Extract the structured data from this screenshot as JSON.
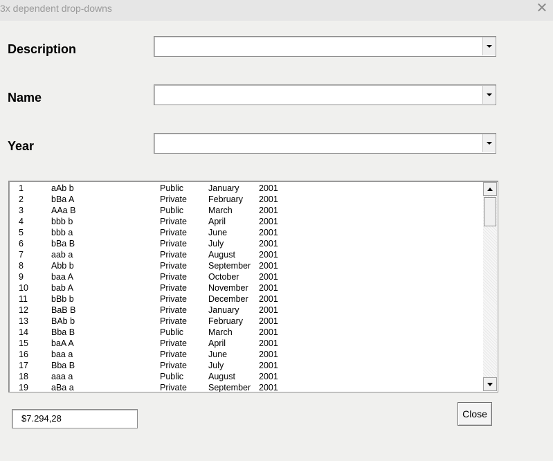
{
  "window": {
    "title": "3x dependent drop-downs",
    "close_glyph": "✕"
  },
  "fields": {
    "description": {
      "label": "Description",
      "value": ""
    },
    "name": {
      "label": "Name",
      "value": ""
    },
    "year": {
      "label": "Year",
      "value": ""
    }
  },
  "list": {
    "rows": [
      [
        "1",
        "aAb b",
        "Public",
        "January",
        "2001"
      ],
      [
        "2",
        "bBa A",
        "Private",
        "February",
        "2001"
      ],
      [
        "3",
        "AAa B",
        "Public",
        "March",
        "2001"
      ],
      [
        "4",
        "bbb b",
        "Private",
        "April",
        "2001"
      ],
      [
        "5",
        "bbb a",
        "Private",
        "June",
        "2001"
      ],
      [
        "6",
        "bBa B",
        "Private",
        "July",
        "2001"
      ],
      [
        "7",
        "aab a",
        "Private",
        "August",
        "2001"
      ],
      [
        "8",
        "Abb b",
        "Private",
        "September",
        "2001"
      ],
      [
        "9",
        "baa A",
        "Private",
        "October",
        "2001"
      ],
      [
        "10",
        "bab A",
        "Private",
        "November",
        "2001"
      ],
      [
        "11",
        "bBb b",
        "Private",
        "December",
        "2001"
      ],
      [
        "12",
        "BaB B",
        "Private",
        "January",
        "2001"
      ],
      [
        "13",
        "BAb b",
        "Private",
        "February",
        "2001"
      ],
      [
        "14",
        "Bba B",
        "Public",
        "March",
        "2001"
      ],
      [
        "15",
        "baA A",
        "Private",
        "April",
        "2001"
      ],
      [
        "16",
        "baa a",
        "Private",
        "June",
        "2001"
      ],
      [
        "17",
        "Bba B",
        "Private",
        "July",
        "2001"
      ],
      [
        "18",
        "aaa a",
        "Public",
        "August",
        "2001"
      ],
      [
        "19",
        "aBa a",
        "Private",
        "September",
        "2001"
      ]
    ]
  },
  "total": {
    "value": "$7.294,28"
  },
  "buttons": {
    "close_label": "Close"
  }
}
